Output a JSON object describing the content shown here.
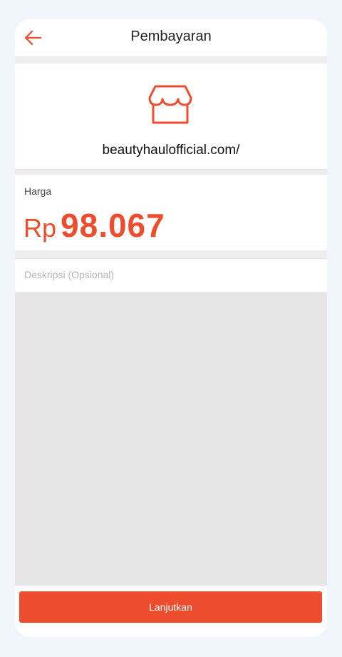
{
  "header": {
    "title": "Pembayaran",
    "back_icon": "arrow-left-icon"
  },
  "store": {
    "icon": "storefront-icon",
    "name": "beautyhaulofficial.com/"
  },
  "price": {
    "label": "Harga",
    "currency": "Rp",
    "amount": "98.067"
  },
  "description": {
    "placeholder": "Deskripsi (Opsional)",
    "value": ""
  },
  "footer": {
    "continue_label": "Lanjutkan"
  },
  "colors": {
    "accent": "#ee4d2d",
    "background": "#f1f6fd",
    "divider": "#ededed",
    "empty_area": "#e6e6e6"
  }
}
